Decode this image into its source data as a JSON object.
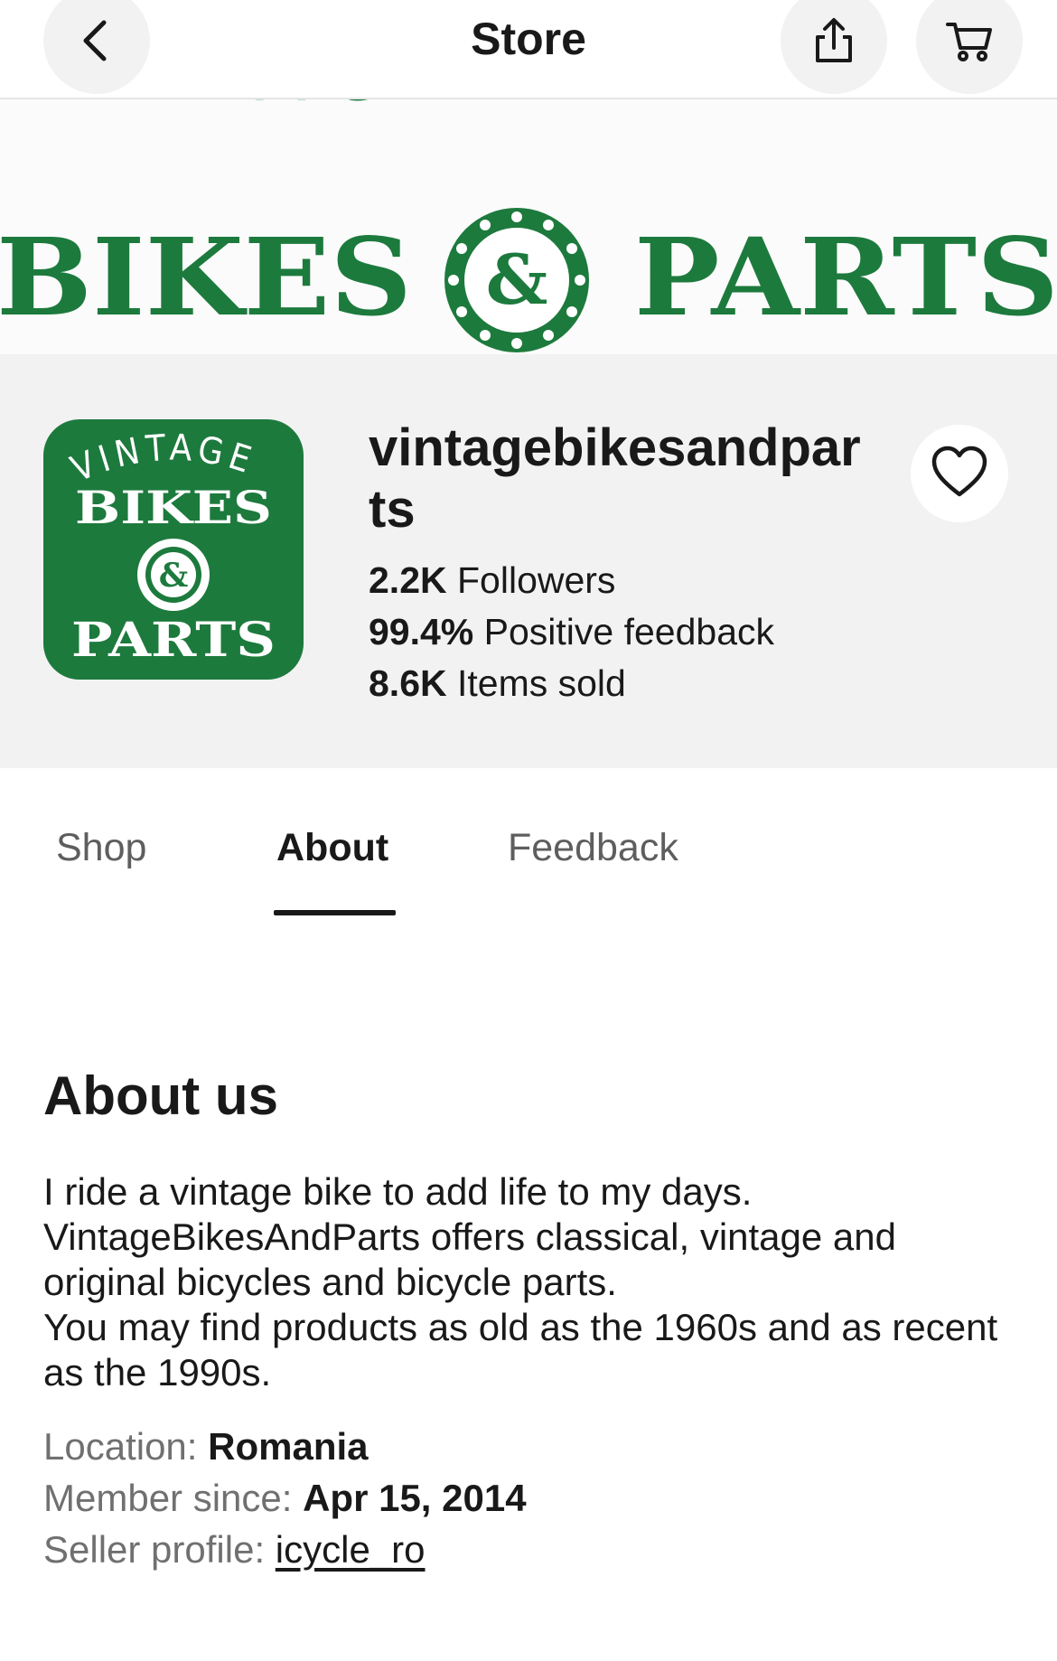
{
  "header": {
    "title": "Store",
    "back_icon": "chevron-left-icon",
    "share_icon": "share-icon",
    "cart_icon": "cart-icon"
  },
  "banner": {
    "logo_text_top": "VINTAGE",
    "logo_text_left": "BIKES",
    "logo_text_right": "PARTS",
    "logo_ampersand": "&",
    "brand_color": "#1d7a3d"
  },
  "store": {
    "name": "vintagebikesandparts",
    "logo_lines": [
      "VINTAGE",
      "BIKES",
      "&",
      "PARTS"
    ],
    "followers_value": "2.2K",
    "followers_label": " Followers",
    "feedback_value": "99.4%",
    "feedback_label": " Positive feedback",
    "sold_value": "8.6K",
    "sold_label": " Items sold",
    "favorite_icon": "heart-outline-icon"
  },
  "tabs": [
    {
      "label": "Shop",
      "active": false
    },
    {
      "label": "About",
      "active": true
    },
    {
      "label": "Feedback",
      "active": false
    }
  ],
  "about": {
    "title": "About us",
    "paragraph_1": "I ride a vintage bike to add life to my days.",
    "paragraph_2": "VintageBikesAndParts offers classical, vintage and original bicycles and bicycle parts.",
    "paragraph_3": "You may find products as old as the 1960s and as recent as the 1990s.",
    "location_label": "Location: ",
    "location_value": "Romania",
    "member_since_label": "Member since: ",
    "member_since_value": "Apr 15, 2014",
    "seller_profile_label": "Seller profile: ",
    "seller_profile_value": "icycle_ro"
  }
}
